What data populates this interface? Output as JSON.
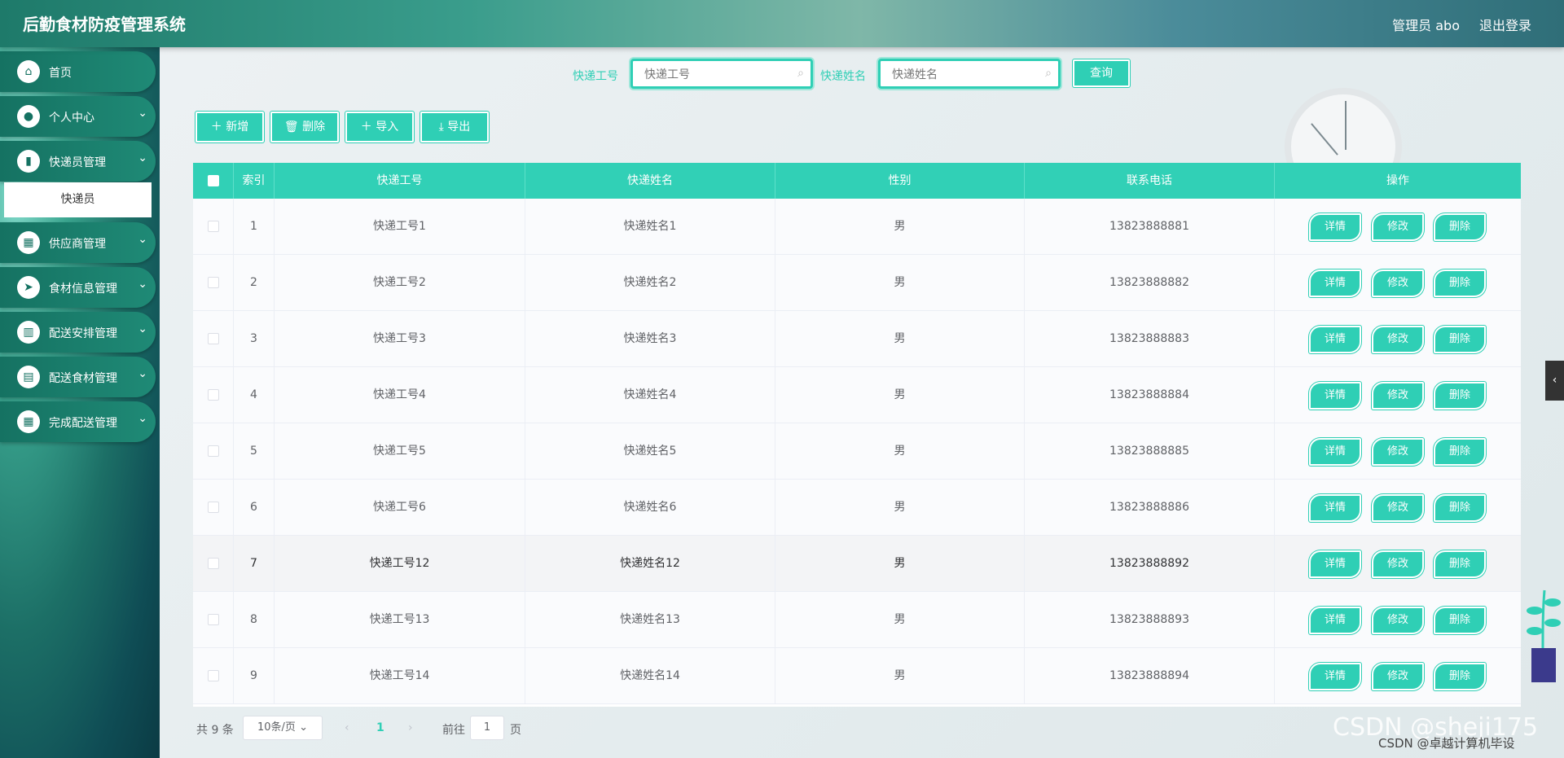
{
  "header": {
    "title": "后勤食材防疫管理系统",
    "user": "管理员 abo",
    "logout": "退出登录"
  },
  "sidebar": {
    "items": [
      {
        "label": "首页",
        "icon": "home-icon",
        "glyph": "⌂"
      },
      {
        "label": "个人中心",
        "icon": "user-icon",
        "glyph": "●"
      },
      {
        "label": "快递员管理",
        "icon": "book-icon",
        "glyph": "▮"
      },
      {
        "label": "供应商管理",
        "icon": "grid-icon",
        "glyph": "▦"
      },
      {
        "label": "食材信息管理",
        "icon": "send-icon",
        "glyph": "➤"
      },
      {
        "label": "配送安排管理",
        "icon": "chart-icon",
        "glyph": "▥"
      },
      {
        "label": "配送食材管理",
        "icon": "message-icon",
        "glyph": "▤"
      },
      {
        "label": "完成配送管理",
        "icon": "grid-icon",
        "glyph": "▦"
      }
    ],
    "submenu": "快递员"
  },
  "search": {
    "label1": "快递工号",
    "placeholder1": "快递工号",
    "label2": "快递姓名",
    "placeholder2": "快递姓名",
    "button": "查询"
  },
  "actions": {
    "add": "＋ 新增",
    "delete": "🗑 删除",
    "import": "＋ 导入",
    "export": "⤓ 导出"
  },
  "table": {
    "headers": [
      "索引",
      "快递工号",
      "快递姓名",
      "性别",
      "联系电话",
      "操作"
    ],
    "rows": [
      {
        "index": "1",
        "id": "快递工号1",
        "name": "快递姓名1",
        "gender": "男",
        "phone": "13823888881"
      },
      {
        "index": "2",
        "id": "快递工号2",
        "name": "快递姓名2",
        "gender": "男",
        "phone": "13823888882"
      },
      {
        "index": "3",
        "id": "快递工号3",
        "name": "快递姓名3",
        "gender": "男",
        "phone": "13823888883"
      },
      {
        "index": "4",
        "id": "快递工号4",
        "name": "快递姓名4",
        "gender": "男",
        "phone": "13823888884"
      },
      {
        "index": "5",
        "id": "快递工号5",
        "name": "快递姓名5",
        "gender": "男",
        "phone": "13823888885"
      },
      {
        "index": "6",
        "id": "快递工号6",
        "name": "快递姓名6",
        "gender": "男",
        "phone": "13823888886"
      },
      {
        "index": "7",
        "id": "快递工号12",
        "name": "快递姓名12",
        "gender": "男",
        "phone": "13823888892"
      },
      {
        "index": "8",
        "id": "快递工号13",
        "name": "快递姓名13",
        "gender": "男",
        "phone": "13823888893"
      },
      {
        "index": "9",
        "id": "快递工号14",
        "name": "快递姓名14",
        "gender": "男",
        "phone": "13823888894"
      }
    ],
    "ops": {
      "detail": "详情",
      "edit": "修改",
      "delete": "删除"
    }
  },
  "pagination": {
    "total": "共 9 条",
    "page_size": "10条/页",
    "current": "1",
    "goto_prefix": "前往",
    "goto_value": "1",
    "goto_suffix": "页"
  },
  "watermark": {
    "big": "CSDN @sheji175",
    "small": "CSDN @卓越计算机毕设"
  },
  "colors": {
    "accent": "#31d0b6",
    "sidebar": "#157262"
  }
}
